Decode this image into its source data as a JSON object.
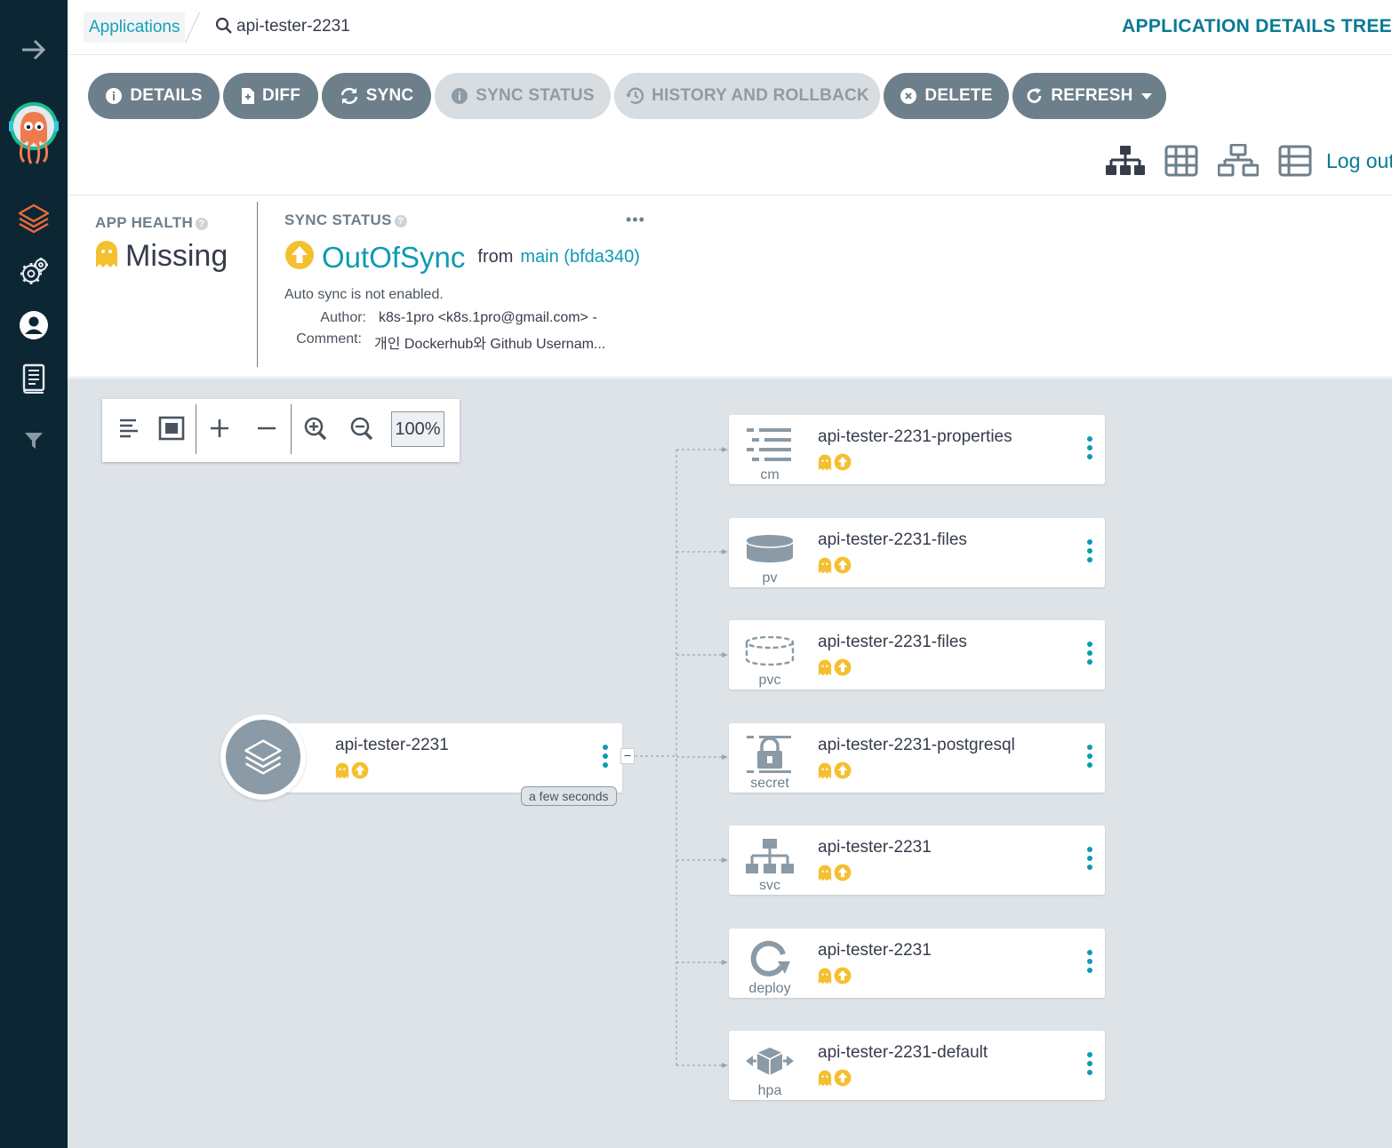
{
  "breadcrumb": {
    "applications": "Applications",
    "current": "api-tester-2231"
  },
  "page_title": "APPLICATION DETAILS TREE",
  "toolbar": {
    "details": "DETAILS",
    "diff": "DIFF",
    "sync": "SYNC",
    "sync_status": "SYNC STATUS",
    "history": "HISTORY AND ROLLBACK",
    "delete": "DELETE",
    "refresh": "REFRESH"
  },
  "logout": "Log out",
  "app_health": {
    "label": "APP HEALTH",
    "value": "Missing"
  },
  "sync_status": {
    "label": "SYNC STATUS",
    "value": "OutOfSync",
    "from_label": "from",
    "revision": "main (bfda340)",
    "auto_sync": "Auto sync is not enabled.",
    "author_label": "Author:",
    "author": "k8s-1pro <k8s.1pro@gmail.com> -",
    "comment_label": "Comment:",
    "comment": "개인 Dockerhub와 Github Usernam..."
  },
  "zoom": "100%",
  "root_node": {
    "name": "api-tester-2231",
    "age": "a few seconds"
  },
  "resources": [
    {
      "name": "api-tester-2231-properties",
      "kind": "cm"
    },
    {
      "name": "api-tester-2231-files",
      "kind": "pv"
    },
    {
      "name": "api-tester-2231-files",
      "kind": "pvc"
    },
    {
      "name": "api-tester-2231-postgresql",
      "kind": "secret"
    },
    {
      "name": "api-tester-2231",
      "kind": "svc"
    },
    {
      "name": "api-tester-2231",
      "kind": "deploy"
    },
    {
      "name": "api-tester-2231-default",
      "kind": "hpa"
    }
  ],
  "colors": {
    "sidebar": "#0d2634",
    "accent": "#0d9ab5",
    "button": "#6d7f8b",
    "missing": "#f4c030",
    "canvas": "#dee3e8"
  }
}
